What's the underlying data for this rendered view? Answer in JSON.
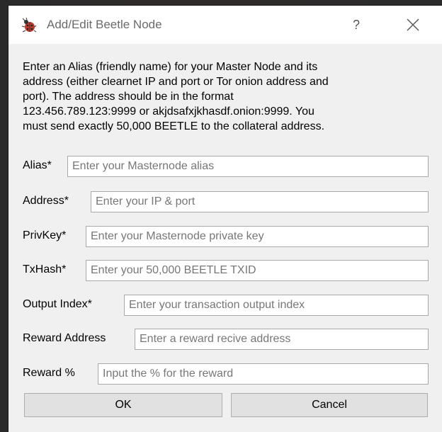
{
  "window": {
    "title": "Add/Edit Beetle Node",
    "help_label": "?",
    "app_icon": "beetle-icon",
    "close_icon": "close-icon"
  },
  "description": {
    "lines": [
      "Enter an Alias (friendly name) for your Master Node and its",
      "address (either clearnet IP and port or Tor onion address and",
      "port). The address should be in the format",
      "123.456.789.123:9999 or akjdsafxjkhasdf.onion:9999. You",
      "must send exactly 50,000 BEETLE to the collateral address."
    ]
  },
  "fields": [
    {
      "label": "Alias*",
      "placeholder": "Enter your Masternode alias",
      "value": ""
    },
    {
      "label": "Address*",
      "placeholder": "Enter your IP & port",
      "value": ""
    },
    {
      "label": "PrivKey*",
      "placeholder": "Enter your Masternode private key",
      "value": ""
    },
    {
      "label": "TxHash*",
      "placeholder": "Enter your 50,000 BEETLE TXID",
      "value": ""
    },
    {
      "label": "Output Index*",
      "placeholder": "Enter your transaction output index",
      "value": ""
    },
    {
      "label": "Reward Address",
      "placeholder": "Enter a reward recive address",
      "value": ""
    },
    {
      "label": "Reward %",
      "placeholder": "Input the % for the reward",
      "value": ""
    }
  ],
  "buttons": {
    "ok_label": "OK",
    "cancel_label": "Cancel"
  },
  "colors": {
    "dialog_bg": "#f0f0f0",
    "titlebar_bg": "#ffffff",
    "icon_red": "#c0392b"
  }
}
